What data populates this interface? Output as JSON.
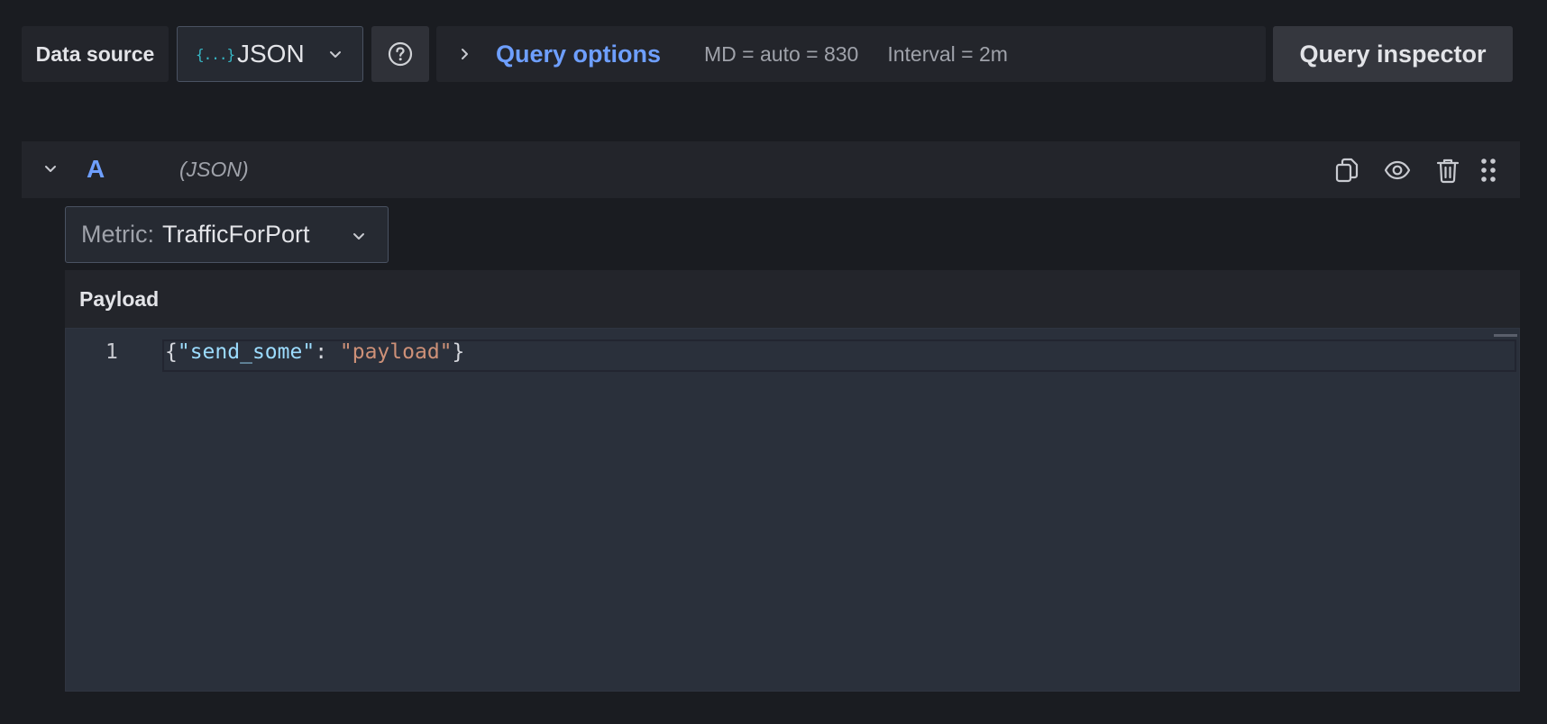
{
  "toolbar": {
    "data_source_label": "Data source",
    "data_source": {
      "icon": "{...}",
      "name": "JSON"
    },
    "help_icon": "question-circle-icon",
    "query_options": {
      "title": "Query options",
      "max_data_points": "MD = auto = 830",
      "interval": "Interval = 2m"
    },
    "query_inspector_label": "Query inspector"
  },
  "query": {
    "ref_id": "A",
    "datasource_name": "(JSON)",
    "actions": [
      "duplicate-icon",
      "eye-icon",
      "trash-icon",
      "drag-handle-icon"
    ],
    "metric": {
      "label": "Metric:",
      "value": "TrafficForPort"
    },
    "payload": {
      "title": "Payload",
      "line_number": "1",
      "tokens": {
        "open": "{",
        "key": "\"send_some\"",
        "colon": ": ",
        "value": "\"payload\"",
        "close": "}"
      }
    }
  },
  "colors": {
    "background": "#1a1c21",
    "panel": "#23252b",
    "accent": "#6e9fff",
    "json_icon": "#36b6c4",
    "editor_bg": "#2a303b",
    "json_key": "#9cdcfe",
    "json_string": "#ce9178"
  }
}
